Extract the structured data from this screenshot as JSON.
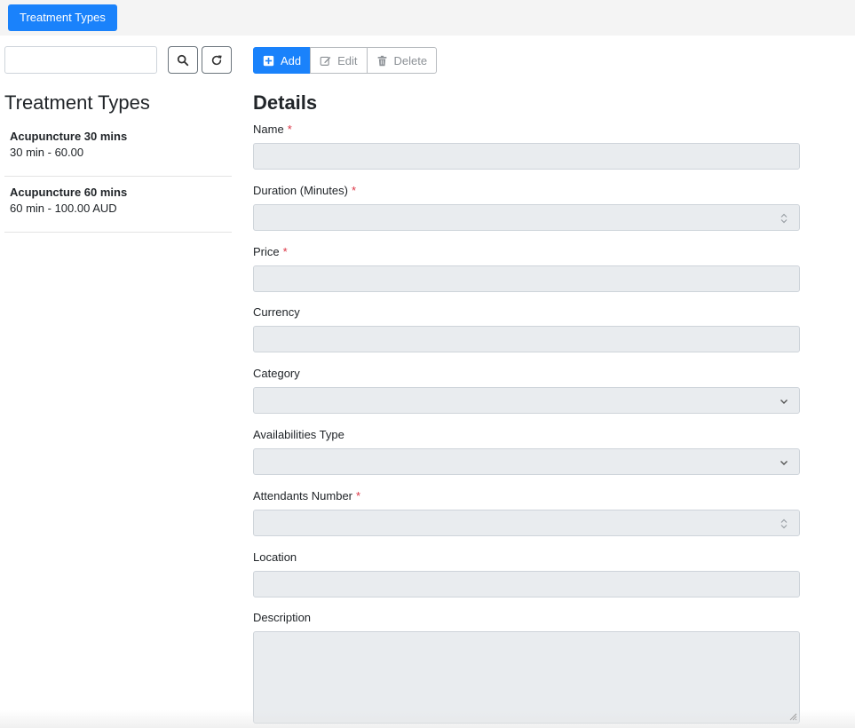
{
  "topbar": {
    "tab_label": "Treatment Types"
  },
  "search": {
    "value": "",
    "placeholder": ""
  },
  "left": {
    "title": "Treatment Types",
    "items": [
      {
        "name": "Acupuncture 30 mins",
        "sub": "30 min - 60.00"
      },
      {
        "name": "Acupuncture 60 mins",
        "sub": "60 min - 100.00 AUD"
      }
    ]
  },
  "toolbar": {
    "add_label": "Add",
    "edit_label": "Edit",
    "delete_label": "Delete"
  },
  "details": {
    "title": "Details",
    "fields": {
      "name": {
        "label": "Name",
        "required_mark": "*"
      },
      "duration": {
        "label": "Duration (Minutes)",
        "required_mark": "*"
      },
      "price": {
        "label": "Price",
        "required_mark": "*"
      },
      "currency": {
        "label": "Currency"
      },
      "category": {
        "label": "Category"
      },
      "availabilities_type": {
        "label": "Availabilities Type"
      },
      "attendants_number": {
        "label": "Attendants Number",
        "required_mark": "*"
      },
      "location": {
        "label": "Location"
      },
      "description": {
        "label": "Description"
      }
    }
  },
  "colors": {
    "accent": "#1a82fb",
    "required": "#dc3545",
    "disabled_field": "#e9ecef"
  }
}
